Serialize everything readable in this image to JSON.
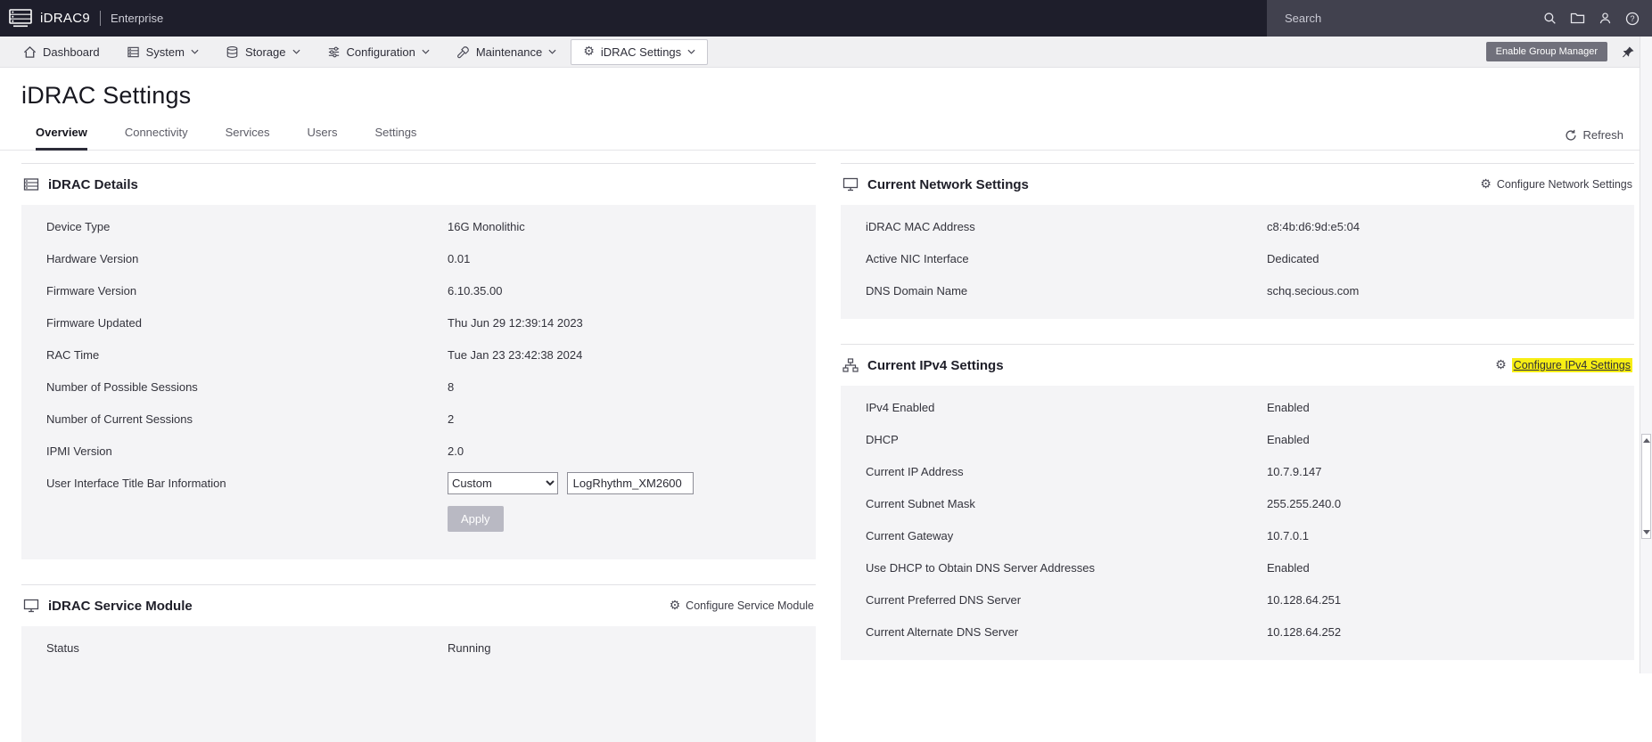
{
  "icons": {
    "gear": "⚙"
  },
  "colors": {
    "topbar_bg": "#1e1e2b",
    "topbar_right_bg": "#41414e",
    "navbar_bg": "#f0f0f2",
    "panel_bg": "#f4f4f6",
    "tab_accent": "#2b2b38",
    "highlight_yellow": "#f7ee14"
  },
  "topbar": {
    "product": "iDRAC9",
    "edition": "Enterprise",
    "search_placeholder": "Search"
  },
  "navbar": {
    "items": [
      {
        "label": "Dashboard"
      },
      {
        "label": "System"
      },
      {
        "label": "Storage"
      },
      {
        "label": "Configuration"
      },
      {
        "label": "Maintenance"
      },
      {
        "label": "iDRAC Settings"
      }
    ],
    "active_item": "iDRAC Settings",
    "enable_group_manager_label": "Enable Group Manager"
  },
  "page": {
    "title": "iDRAC Settings",
    "tabs": [
      "Overview",
      "Connectivity",
      "Services",
      "Users",
      "Settings"
    ],
    "active_tab": "Overview",
    "refresh_label": "Refresh"
  },
  "idrac_details": {
    "title": "iDRAC Details",
    "rows": [
      {
        "label": "Device Type",
        "value": "16G Monolithic"
      },
      {
        "label": "Hardware Version",
        "value": "0.01"
      },
      {
        "label": "Firmware Version",
        "value": "6.10.35.00"
      },
      {
        "label": "Firmware Updated",
        "value": "Thu Jun 29 12:39:14 2023"
      },
      {
        "label": "RAC Time",
        "value": "Tue Jan 23 23:42:38 2024"
      },
      {
        "label": "Number of Possible Sessions",
        "value": "8"
      },
      {
        "label": "Number of Current Sessions",
        "value": "2"
      },
      {
        "label": "IPMI Version",
        "value": "2.0"
      }
    ],
    "title_bar": {
      "label": "User Interface Title Bar Information",
      "select_value": "Custom",
      "input_value": "LogRhythm_XM2600"
    },
    "apply_label": "Apply"
  },
  "service_module": {
    "title": "iDRAC Service Module",
    "configure_label": "Configure Service Module",
    "rows": [
      {
        "label": "Status",
        "value": "Running"
      }
    ]
  },
  "network_settings": {
    "title": "Current Network Settings",
    "configure_label": "Configure Network Settings",
    "rows": [
      {
        "label": "iDRAC MAC Address",
        "value": "c8:4b:d6:9d:e5:04"
      },
      {
        "label": "Active NIC Interface",
        "value": "Dedicated"
      },
      {
        "label": "DNS Domain Name",
        "value": "schq.secious.com"
      }
    ]
  },
  "ipv4_settings": {
    "title": "Current IPv4 Settings",
    "configure_label": "Configure IPv4 Settings",
    "rows": [
      {
        "label": "IPv4 Enabled",
        "value": "Enabled"
      },
      {
        "label": "DHCP",
        "value": "Enabled"
      },
      {
        "label": "Current IP Address",
        "value": "10.7.9.147"
      },
      {
        "label": "Current Subnet Mask",
        "value": "255.255.240.0"
      },
      {
        "label": "Current Gateway",
        "value": "10.7.0.1"
      },
      {
        "label": "Use DHCP to Obtain DNS Server Addresses",
        "value": "Enabled"
      },
      {
        "label": "Current Preferred DNS Server",
        "value": "10.128.64.251"
      },
      {
        "label": "Current Alternate DNS Server",
        "value": "10.128.64.252"
      }
    ]
  }
}
